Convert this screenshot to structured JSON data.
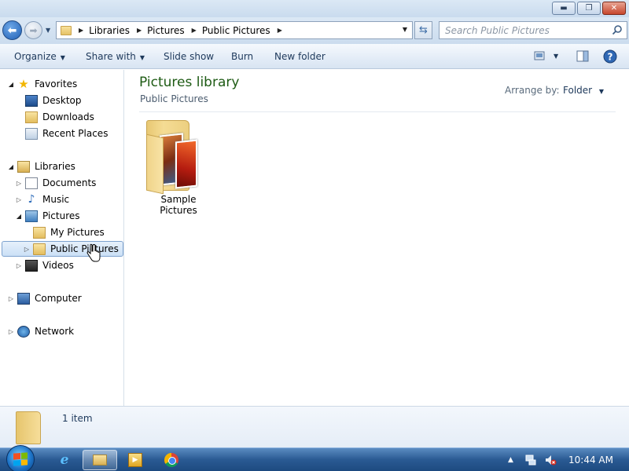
{
  "window": {
    "minimize_label": "▬",
    "restore_label": "❐",
    "close_label": "✕"
  },
  "address": {
    "crumbs": [
      "Libraries",
      "Pictures",
      "Public Pictures"
    ]
  },
  "search": {
    "placeholder": "Search Public Pictures"
  },
  "toolbar": {
    "organize": "Organize",
    "share_with": "Share with",
    "slide_show": "Slide show",
    "burn": "Burn",
    "new_folder": "New folder"
  },
  "nav": {
    "favorites": "Favorites",
    "desktop": "Desktop",
    "downloads": "Downloads",
    "recent_places": "Recent Places",
    "libraries": "Libraries",
    "documents": "Documents",
    "music": "Music",
    "pictures": "Pictures",
    "my_pictures": "My Pictures",
    "public_pictures": "Public Pictures",
    "videos": "Videos",
    "computer": "Computer",
    "network": "Network"
  },
  "content": {
    "title": "Pictures library",
    "subtitle": "Public Pictures",
    "arrange_label": "Arrange by:",
    "arrange_value": "Folder",
    "items": [
      {
        "name": "Sample Pictures"
      }
    ]
  },
  "details": {
    "count": "1 item"
  },
  "taskbar": {
    "clock": "10:44 AM"
  },
  "colors": {
    "title_green": "#1e5b14",
    "link_blue": "#1e395b",
    "selection": "#cbe0f6"
  }
}
